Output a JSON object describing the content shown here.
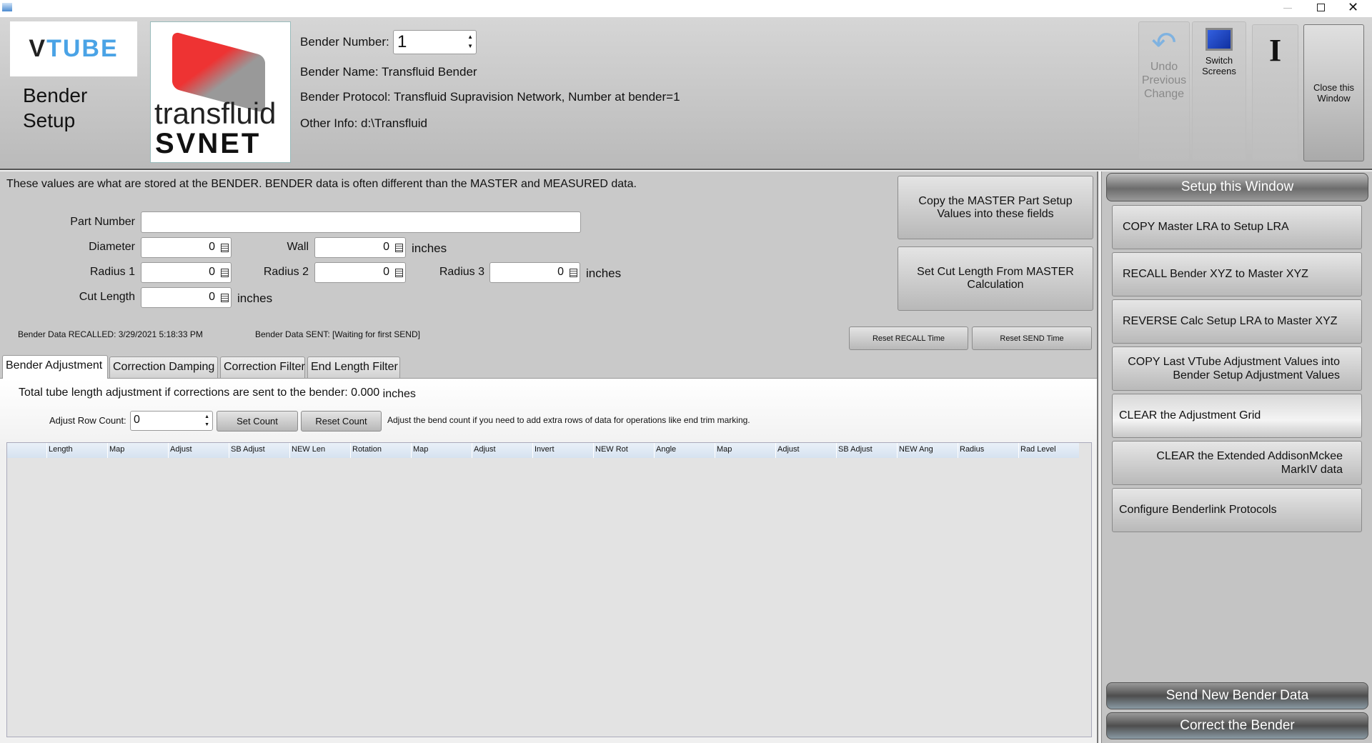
{
  "window": {
    "controls": [
      "minimize",
      "restore",
      "close"
    ]
  },
  "header": {
    "vtube_logo": "VTUBE",
    "title_line1": "Bender",
    "title_line2": "Setup",
    "transfluid_logo": {
      "line1": "transfluid",
      "line2": "SVNET"
    },
    "bender_number_label": "Bender Number:",
    "bender_number_value": "1",
    "bender_name": "Bender Name: Transfluid Bender",
    "bender_protocol": "Bender Protocol: Transfluid Supravision Network, Number at bender=1",
    "other_info": "Other Info: d:\\Transfluid"
  },
  "toolbar": {
    "undo": "Undo Previous Change",
    "switch": "Switch Screens",
    "cursor_glyph": "I",
    "close": "Close this Window"
  },
  "form": {
    "intro": "These values are what are stored at the BENDER.  BENDER data is often different than the MASTER and MEASURED data.",
    "part_number_label": "Part Number",
    "part_number_value": "",
    "diameter_label": "Diameter",
    "diameter_value": "0",
    "wall_label": "Wall",
    "wall_value": "0",
    "radius1_label": "Radius 1",
    "radius1_value": "0",
    "radius2_label": "Radius 2",
    "radius2_value": "0",
    "radius3_label": "Radius 3",
    "radius3_value": "0",
    "cut_length_label": "Cut Length",
    "cut_length_value": "0",
    "units": "inches",
    "copy_master_btn": "Copy the MASTER Part Setup Values into these fields",
    "set_cut_btn": "Set Cut Length From MASTER Calculation",
    "recalled": "Bender Data RECALLED: 3/29/2021 5:18:33 PM",
    "sent": "Bender Data SENT: [Waiting for first SEND]",
    "reset_recall": "Reset RECALL Time",
    "reset_send": "Reset SEND Time"
  },
  "tabs": [
    "Bender Adjustment",
    "Correction Damping",
    "Correction Filter",
    "End Length Filter"
  ],
  "adjust": {
    "total_text": "Total tube length adjustment if corrections are sent to the bender: 0.000",
    "total_units": "inches",
    "row_count_label": "Adjust Row Count:",
    "row_count_value": "0",
    "set_count": "Set Count",
    "reset_count": "Reset Count",
    "note": "Adjust the bend count if you need to add extra rows of data for operations like end trim marking.",
    "columns": [
      "Length",
      "Map",
      "Adjust",
      "SB Adjust",
      "NEW Len",
      "Rotation",
      "Map",
      "Adjust",
      "Invert",
      "NEW Rot",
      "Angle",
      "Map",
      "Adjust",
      "SB Adjust",
      "NEW Ang",
      "Radius",
      "Rad Level"
    ]
  },
  "side": {
    "header": "Setup this Window",
    "buttons": [
      "COPY Master LRA to Setup LRA",
      "RECALL Bender XYZ to Master XYZ",
      "REVERSE Calc Setup LRA to Master XYZ",
      "COPY Last VTube Adjustment Values into Bender Setup Adjustment Values",
      "CLEAR the Adjustment Grid",
      "CLEAR the Extended AddisonMckee MarkIV data",
      "Configure Benderlink Protocols"
    ],
    "send": "Send New Bender Data",
    "correct": "Correct the Bender"
  }
}
